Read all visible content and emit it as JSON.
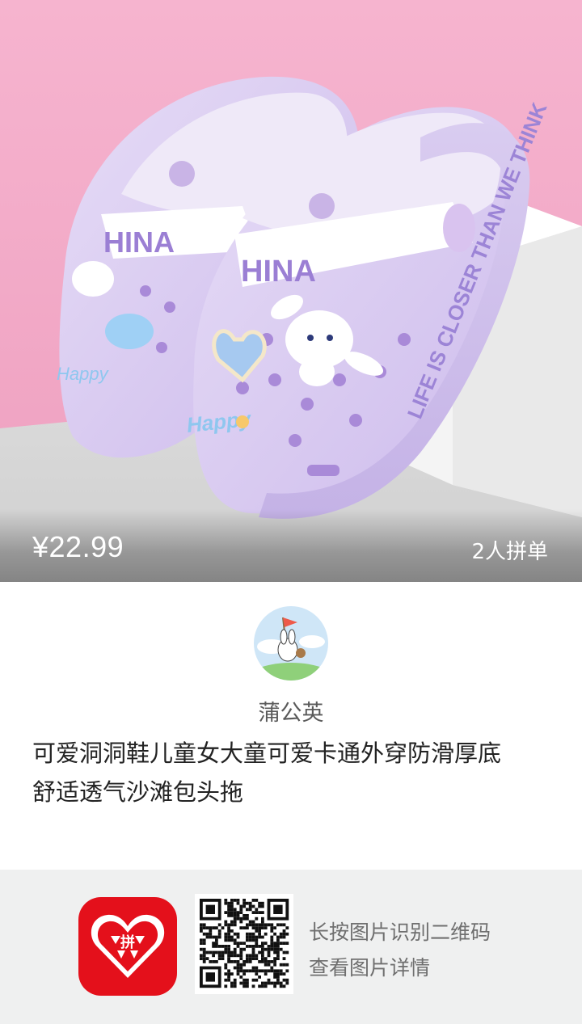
{
  "product": {
    "price": "¥22.99",
    "group_buy": "2人拼单",
    "title_line1": "可爱洞洞鞋儿童女大童可爱卡通外穿防滑厚底",
    "title_line2": "舒适透气沙滩包头拖"
  },
  "shop": {
    "name": "蒲公英",
    "avatar_icon": "bunny-flag-avatar-icon"
  },
  "footer": {
    "app_logo_icon": "pinduoduo-logo-icon",
    "qr_icon": "qr-code-icon",
    "hint_line1": "长按图片识别二维码",
    "hint_line2": "查看图片详情"
  },
  "colors": {
    "hero_pink": "#f2a9c6",
    "shoe_lavender": "#d8c9f0",
    "brand_red": "#e4101b",
    "footer_bg": "#eff0f0"
  }
}
